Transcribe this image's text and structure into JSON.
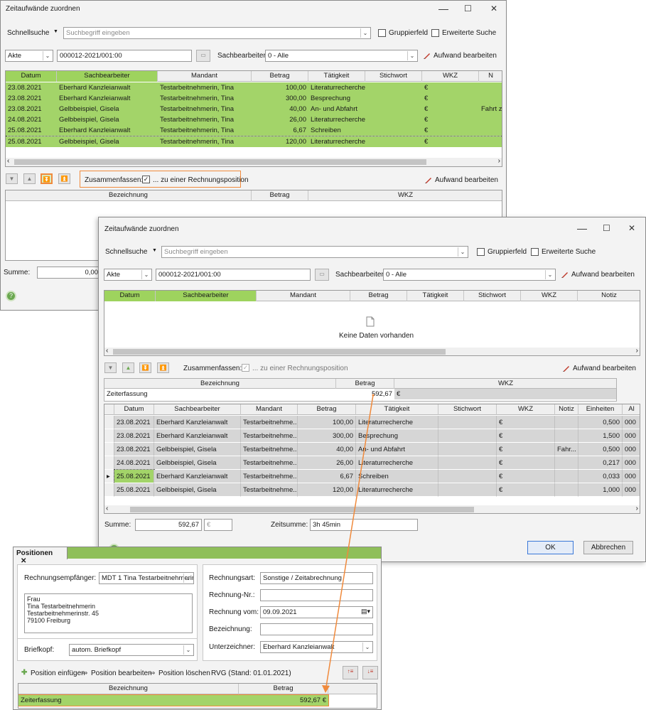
{
  "window_title": "Zeitaufwände zuordnen",
  "window_controls": {
    "minimize": "—",
    "maximize": "☐",
    "close": "✕"
  },
  "search": {
    "label": "Schnellsuche",
    "placeholder": "Suchbegriff eingeben",
    "group_label": "Gruppierfeld",
    "advanced_label": "Erweiterte Suche"
  },
  "filter": {
    "type_value": "Akte",
    "file_value": "000012-2021/001:00",
    "clerk_label": "Sachbearbeiter:",
    "clerk_value": "0 - Alle",
    "edit_label": "Aufwand bearbeiten"
  },
  "top_grid_bg": {
    "headers": [
      "Datum",
      "Sachbearbeiter",
      "Mandant",
      "Betrag",
      "Tätigkeit",
      "Stichwort",
      "WKZ",
      "N"
    ],
    "rows": [
      [
        "23.08.2021",
        "Eberhard Kanzleianwalt",
        "Testarbeitnehmerin, Tina",
        "100,00",
        "Literaturrecherche",
        "",
        "€",
        ""
      ],
      [
        "23.08.2021",
        "Eberhard Kanzleianwalt",
        "Testarbeitnehmerin, Tina",
        "300,00",
        "Besprechung",
        "",
        "€",
        ""
      ],
      [
        "23.08.2021",
        "Gelbbeispiel, Gisela",
        "Testarbeitnehmerin, Tina",
        "40,00",
        "An- und Abfahrt",
        "",
        "€",
        "Fahrt zu"
      ],
      [
        "24.08.2021",
        "Gelbbeispiel, Gisela",
        "Testarbeitnehmerin, Tina",
        "26,00",
        "Literaturrecherche",
        "",
        "€",
        ""
      ],
      [
        "25.08.2021",
        "Eberhard Kanzleianwalt",
        "Testarbeitnehmerin, Tina",
        "6,67",
        "Schreiben",
        "",
        "€",
        ""
      ],
      [
        "25.08.2021",
        "Gelbbeispiel, Gisela",
        "Testarbeitnehmerin, Tina",
        "120,00",
        "Literaturrecherche",
        "",
        "€",
        ""
      ]
    ]
  },
  "summarize": {
    "label": "Zusammenfassen:",
    "option": "... zu einer Rechnungsposition"
  },
  "bottom_grid_headers": [
    "Bezeichnung",
    "Betrag",
    "WKZ"
  ],
  "sum_label": "Summe:",
  "sum_bg": "0,00",
  "fg": {
    "top_headers": [
      "Datum",
      "Sachbearbeiter",
      "Mandant",
      "Betrag",
      "Tätigkeit",
      "Stichwort",
      "WKZ",
      "Notiz"
    ],
    "no_data": "Keine Daten vorhanden",
    "position_row": {
      "label": "Zeiterfassung",
      "amount": "592,67",
      "currency": "€"
    },
    "detail_headers": [
      "Datum",
      "Sachbearbeiter",
      "Mandant",
      "Betrag",
      "Tätigkeit",
      "Stichwort",
      "WKZ",
      "Notiz",
      "Einheiten",
      "Al"
    ],
    "detail_rows": [
      [
        "23.08.2021",
        "Eberhard Kanzleianwalt",
        "Testarbeitnehme...",
        "100,00",
        "Literaturrecherche",
        "",
        "€",
        "",
        "0,500",
        "000"
      ],
      [
        "23.08.2021",
        "Eberhard Kanzleianwalt",
        "Testarbeitnehme...",
        "300,00",
        "Besprechung",
        "",
        "€",
        "",
        "1,500",
        "000"
      ],
      [
        "23.08.2021",
        "Gelbbeispiel, Gisela",
        "Testarbeitnehme...",
        "40,00",
        "An- und Abfahrt",
        "",
        "€",
        "Fahr...",
        "0,500",
        "000"
      ],
      [
        "24.08.2021",
        "Gelbbeispiel, Gisela",
        "Testarbeitnehme...",
        "26,00",
        "Literaturrecherche",
        "",
        "€",
        "",
        "0,217",
        "000"
      ],
      [
        "25.08.2021",
        "Eberhard Kanzleianwalt",
        "Testarbeitnehme...",
        "6,67",
        "Schreiben",
        "",
        "€",
        "",
        "0,033",
        "000"
      ],
      [
        "25.08.2021",
        "Gelbbeispiel, Gisela",
        "Testarbeitnehme...",
        "120,00",
        "Literaturrecherche",
        "",
        "€",
        "",
        "1,000",
        "000"
      ]
    ],
    "sum_value": "592,67",
    "sum_currency": "€",
    "time_sum_label": "Zeitsumme:",
    "time_sum_value": "3h 45min",
    "ok": "OK",
    "cancel": "Abbrechen"
  },
  "positions": {
    "tab": "Positionen",
    "recipient_label": "Rechnungsempfänger:",
    "recipient_value": "MDT 1 Tina Testarbeitnehmerin",
    "address": [
      "Frau",
      "Tina Testarbeitnehmerin",
      "Testarbeitnehmerinstr. 45",
      "79100 Freiburg"
    ],
    "letterhead_label": "Briefkopf:",
    "letterhead_value": "autom. Briefkopf",
    "invoice_type_label": "Rechnungsart:",
    "invoice_type_value": "Sonstige / Zeitabrechnung",
    "invoice_no_label": "Rechnung-Nr.:",
    "invoice_date_label": "Rechnung vom:",
    "invoice_date_value": "09.09.2021",
    "designation_label": "Bezeichnung:",
    "signer_label": "Unterzeichner:",
    "signer_value": "Eberhard Kanzleianwalt",
    "actions": [
      "Position einfügen",
      "Position bearbeiten",
      "Position löschen"
    ],
    "rvg": "RVG (Stand: 01.01.2021)",
    "grid_headers": [
      "Bezeichnung",
      "Betrag"
    ],
    "row": {
      "label": "Zeiterfassung",
      "amount": "592,67 €"
    }
  },
  "colors": {
    "green": "#a3d469",
    "orange": "#f08a3c",
    "selected_header": "#9ed35e"
  }
}
